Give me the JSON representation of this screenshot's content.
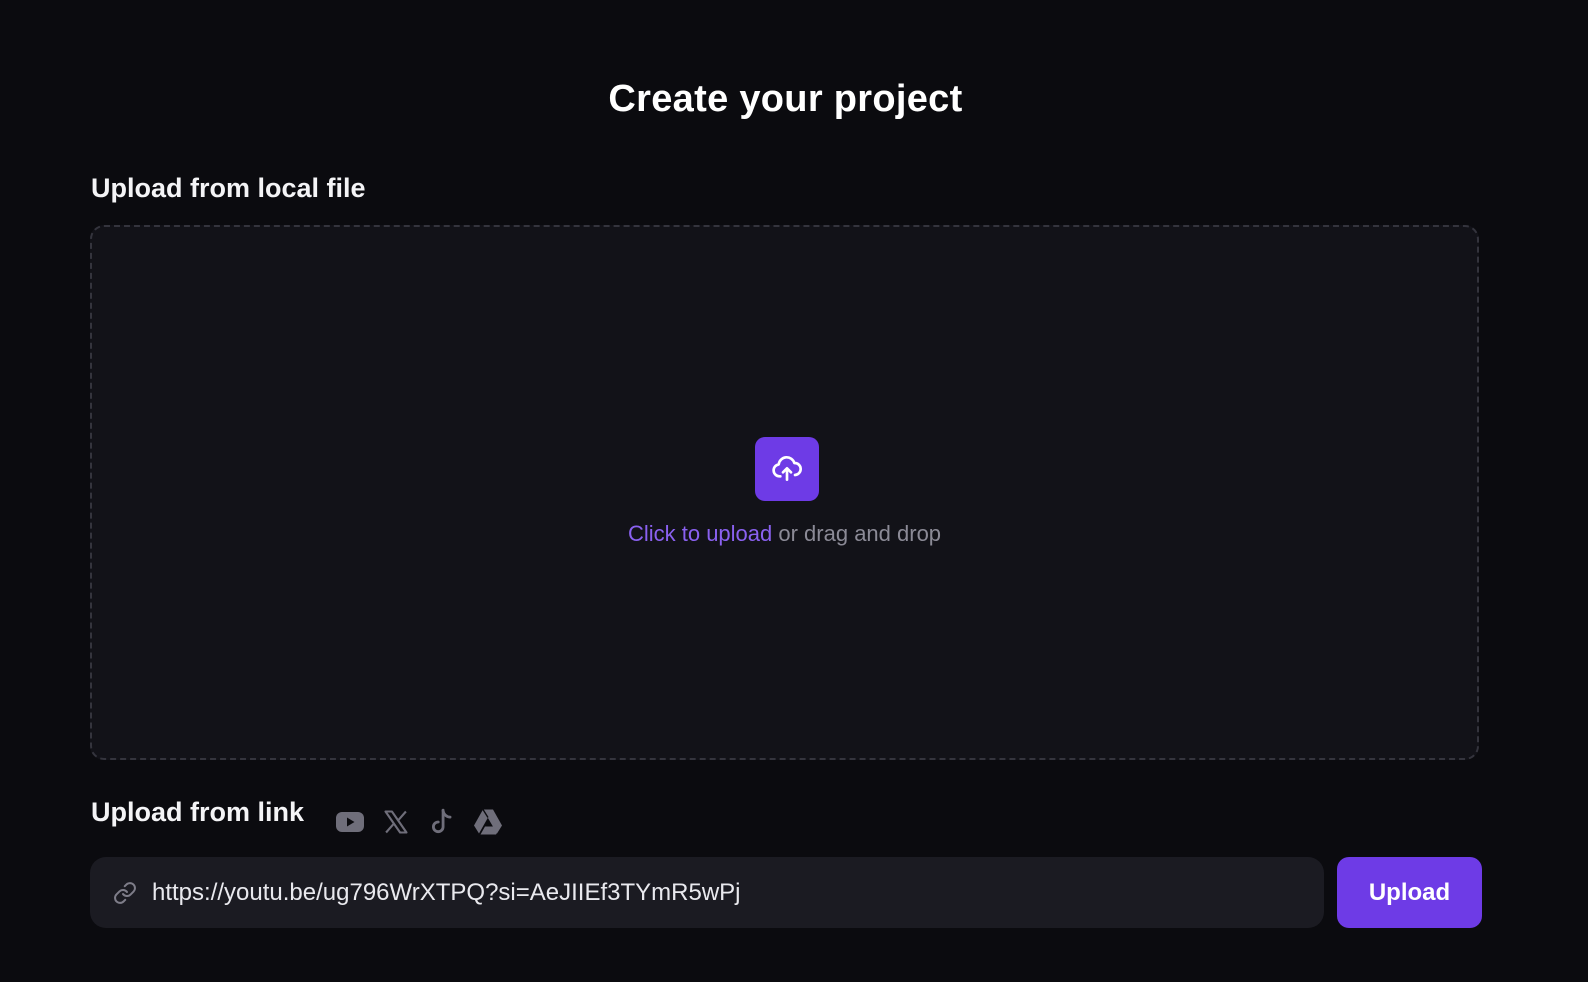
{
  "page": {
    "title": "Create your project"
  },
  "local_upload": {
    "section_label": "Upload from local file",
    "icon": "cloud-upload-icon",
    "click_text": "Click to upload",
    "drag_text": " or drag and drop"
  },
  "link_upload": {
    "section_label": "Upload from link",
    "platforms": [
      {
        "name": "youtube",
        "icon": "youtube-icon"
      },
      {
        "name": "x",
        "icon": "x-icon"
      },
      {
        "name": "tiktok",
        "icon": "tiktok-icon"
      },
      {
        "name": "google-drive",
        "icon": "google-drive-icon"
      }
    ],
    "input_icon": "link-icon",
    "input_value": "https://youtu.be/ug796WrXTPQ?si=AeJIIEf3TYmR5wPj",
    "button_label": "Upload"
  },
  "colors": {
    "background": "#0b0b0f",
    "accent": "#6e3be6",
    "accent_text": "#8a61f0",
    "muted_text": "#8b8a96",
    "icon_gray": "#6f6e7a"
  }
}
